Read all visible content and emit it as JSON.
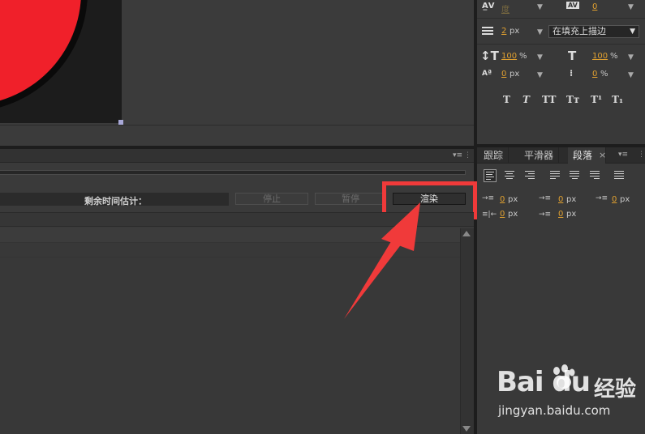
{
  "character_panel": {
    "kerning_value": "度",
    "tracking_value": "0",
    "stroke_width_value": "2",
    "stroke_width_unit": "px",
    "stroke_mode": "在填充上描边",
    "vertical_scale_value": "100",
    "vertical_scale_unit": "%",
    "horizontal_scale_value": "100",
    "horizontal_scale_unit": "%",
    "baseline_shift_value": "0",
    "baseline_shift_unit": "px",
    "tsume_value": "0",
    "tsume_unit": "%",
    "style_buttons": [
      "T",
      "T",
      "TT",
      "Tт",
      "T¹",
      "T₁"
    ]
  },
  "render_queue": {
    "eta_label": "剩余时间估计：",
    "stop_label": "停止",
    "pause_label": "暂停",
    "render_label": "渲染"
  },
  "paragraph_panel": {
    "tabs": [
      "跟踪",
      "平滑器",
      "段落"
    ],
    "active_tab": "段落",
    "indent_left_value": "0",
    "indent_right_value": "0",
    "indent_first_value": "0",
    "space_before_value": "0",
    "space_after_value": "0",
    "unit": "px"
  },
  "watermark": {
    "logo_text": "Bai du",
    "brand_cn": "经验",
    "url": "jingyan.baidu.com"
  },
  "colors": {
    "highlight": "#f03a3a",
    "accent_value": "#e0a030",
    "circle": "#f0202a"
  }
}
